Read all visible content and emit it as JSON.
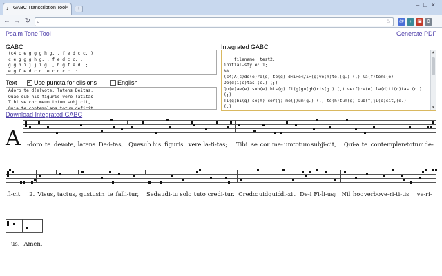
{
  "browser": {
    "tab_title": "GABC Transcription Tool",
    "tab_close": "×",
    "new_tab": "+",
    "window_controls": "–□×",
    "back": "←",
    "forward": "→",
    "reload": "↻",
    "address": "",
    "icons": [
      "search-icon",
      "star-icon",
      "extension-icons",
      "wrench-icon"
    ]
  },
  "page": {
    "psalm_tone_link": "Psalm Tone Tool",
    "generate_pdf_link": "Generate PDF",
    "gabc_label": "GABC",
    "gabc_value": "(c4 c e g g g h g. , f e d c c. )\nc e g g g h g. , f e d c c. ;\ng g h i j j i g. , h g f e d. ;\ne g f e d c d. e c d c c. ::",
    "text_label": "Text",
    "use_puncta_label": "Use puncta for elisions",
    "use_puncta_checked": "✓",
    "english_label": "English",
    "text_value": "Adoro te d(e)vote, latens Deitas,\nQuae sub his figuris vere latitas :\nTibi se cor meum totum subjicit,\nQuia te contemplans totum deficit.",
    "integrated_label": "Integrated GABC",
    "integrated_value": "filename: test2;\ninitial-style: 1;\n%%\n(c4)A(c)do(e)ro(g) te(g) d<i>e</i>(g)vo(h)te,(g.) (,) la(f)tens(e)\nDe(d)i(c)tas,(c.) (;)\nQu(e)ae(e) sub(e) his(g) fi(g)gu(gh)ris(g.) (,) ve(f)re(e) la(d)ti(c)tas (c.)\n(;)\nTi(g)bi(g) se(h) cor(j) me(j)um(g.) (,) to(h)tum(g) sub(f)ji(e)cit,(d.)\n(;)\nQui(e)a(g) te(f) con(e)tem(dc)plans(d.) (,) to(e)tum(c) de(d)fi(c)cit.(c.)\n(::)",
    "download_link": "Download Integrated GABC"
  },
  "score": {
    "initial": "A",
    "line1": [
      "-doro",
      "te",
      "devote,",
      "latens",
      "De-i-tas,",
      "Quæ",
      "sub",
      "his",
      "figuris",
      "vere",
      "la-ti-tas;",
      "Tibi",
      "se",
      "cor",
      "me-",
      "um",
      "totum",
      "subji-cit,",
      "Qui-a",
      "te",
      "contemplans",
      "totum",
      "de-"
    ],
    "line2": [
      "fi-cit.",
      "2.",
      "Visus,",
      "tactus,",
      "gustus",
      "in",
      "te",
      "falli-tur,",
      "Sed",
      "audi-tu",
      "solo",
      "tuto",
      "credi-tur.",
      "Credo",
      "quidquid",
      "di-xit",
      "De-i",
      "Fi-li-us;",
      "Nil",
      "hoc",
      "verbo",
      "ve-ri-ti-tis",
      "ve-ri-"
    ],
    "line3": [
      "us.",
      "Amen."
    ]
  }
}
